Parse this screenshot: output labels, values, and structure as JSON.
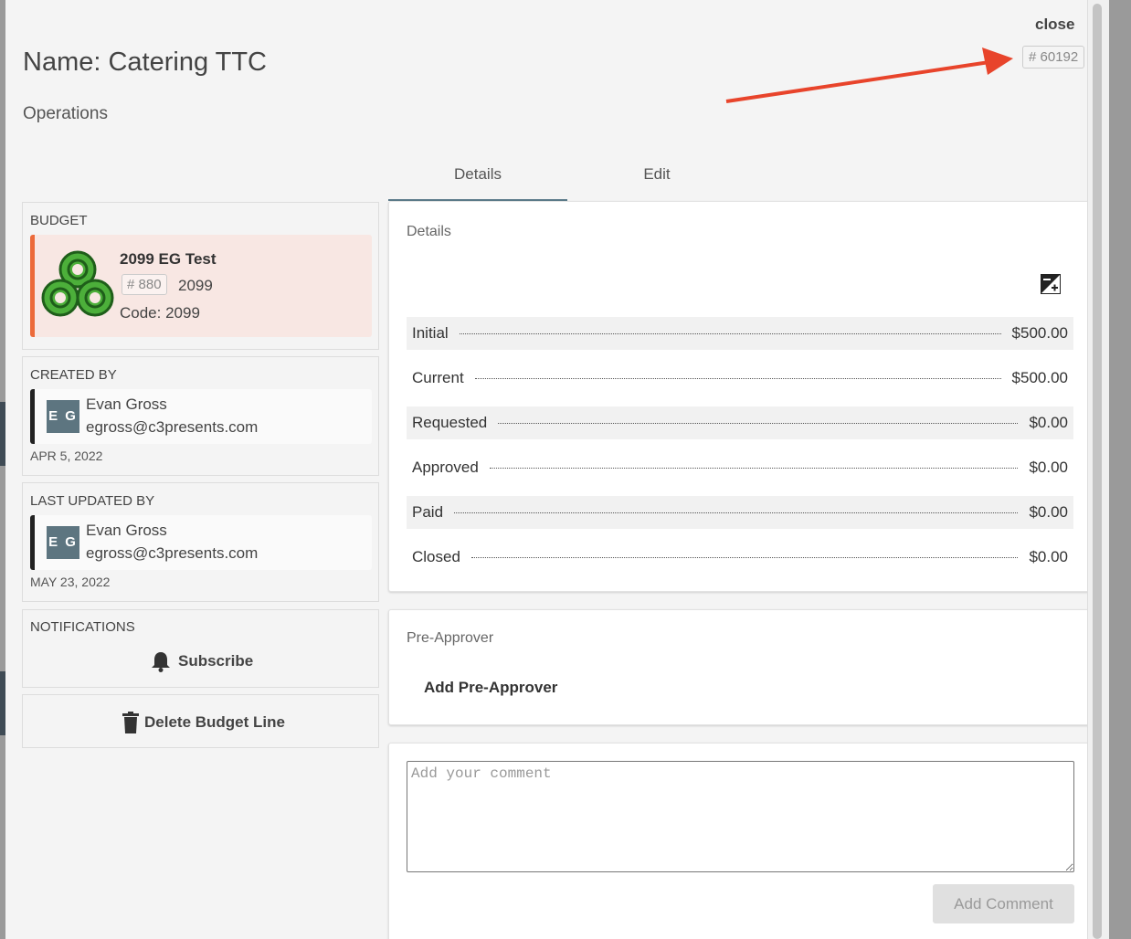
{
  "header": {
    "close_label": "close",
    "id_badge": "# 60192",
    "title": "Name: Catering TTC",
    "subtitle": "Operations"
  },
  "tabs": [
    {
      "label": "Details",
      "active": true
    },
    {
      "label": "Edit",
      "active": false
    }
  ],
  "budget": {
    "section_label": "BUDGET",
    "name": "2099 EG Test",
    "badge": "# 880",
    "year": "2099",
    "code": "Code: 2099"
  },
  "created_by": {
    "section_label": "CREATED BY",
    "initials": "E G",
    "name": "Evan Gross",
    "email": "egross@c3presents.com",
    "date": "APR 5, 2022"
  },
  "last_updated_by": {
    "section_label": "LAST UPDATED BY",
    "initials": "E G",
    "name": "Evan Gross",
    "email": "egross@c3presents.com",
    "date": "MAY 23, 2022"
  },
  "notifications": {
    "section_label": "NOTIFICATIONS",
    "subscribe_label": "Subscribe"
  },
  "delete_label": "Delete Budget Line",
  "details": {
    "title": "Details",
    "rows": [
      {
        "label": "Initial",
        "value": "$500.00"
      },
      {
        "label": "Current",
        "value": "$500.00"
      },
      {
        "label": "Requested",
        "value": "$0.00"
      },
      {
        "label": "Approved",
        "value": "$0.00"
      },
      {
        "label": "Paid",
        "value": "$0.00"
      },
      {
        "label": "Closed",
        "value": "$0.00"
      }
    ]
  },
  "pre_approver": {
    "title": "Pre-Approver",
    "add_label": "Add Pre-Approver"
  },
  "comment": {
    "placeholder": "Add your comment",
    "button_label": "Add Comment"
  },
  "colors": {
    "accent_orange": "#ec6a3a",
    "budget_bg": "#f8e7e3",
    "avatar": "#5d7580",
    "tab_underline": "#5c7b8a",
    "annotation_arrow": "#e8442b"
  }
}
